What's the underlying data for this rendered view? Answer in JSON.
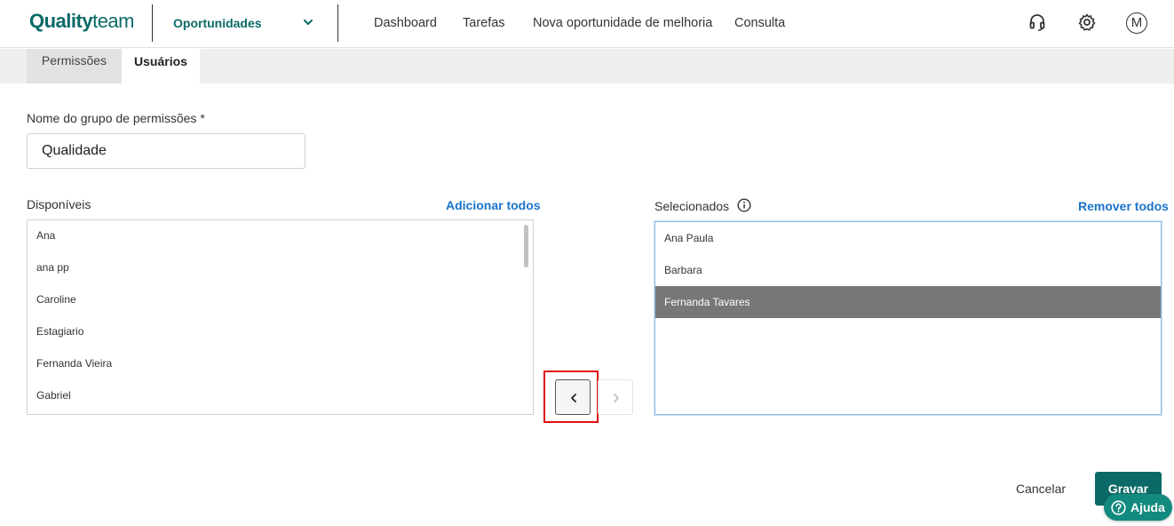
{
  "header": {
    "logo_bold": "Quality",
    "logo_light": "team",
    "module_name": "Oportunidades",
    "nav": [
      "Dashboard",
      "Tarefas",
      "Nova oportunidade de melhoria",
      "Consulta"
    ],
    "avatar_initial": "M"
  },
  "tabs": [
    {
      "label": "Permissões",
      "active": false
    },
    {
      "label": "Usuários",
      "active": true
    }
  ],
  "form": {
    "group_name_label": "Nome do grupo de permissões *",
    "group_name_value": "Qualidade"
  },
  "available": {
    "title": "Disponíveis",
    "action": "Adicionar todos",
    "items": [
      "Ana",
      "ana pp",
      "Caroline",
      "Estagiario",
      "Fernanda Vieira",
      "Gabriel"
    ]
  },
  "selected": {
    "title": "Selecionados",
    "action": "Remover todos",
    "items": [
      "Ana Paula",
      "Barbara",
      "Fernanda Tavares"
    ],
    "highlighted_index": 2
  },
  "footer": {
    "cancel_label": "Cancelar",
    "save_label": "Gravar",
    "help_label": "Ajuda"
  },
  "colors": {
    "brand": "#0b6a67",
    "link": "#1a73c9",
    "highlight": "#e01010",
    "selected_row": "#777777"
  }
}
